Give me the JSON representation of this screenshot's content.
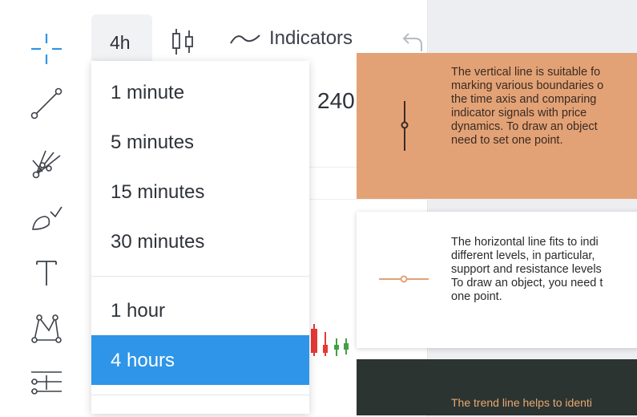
{
  "toolbar": {
    "timeframe_label": "4h",
    "indicators_label": "Indicators"
  },
  "chart": {
    "price_fragment": "240"
  },
  "timeframe_menu": {
    "items": [
      {
        "label": "1 minute",
        "selected": false
      },
      {
        "label": "5 minutes",
        "selected": false
      },
      {
        "label": "15 minutes",
        "selected": false
      },
      {
        "label": "30 minutes",
        "selected": false
      },
      {
        "label": "1 hour",
        "selected": false
      },
      {
        "label": "4 hours",
        "selected": true
      }
    ]
  },
  "tooltips": [
    {
      "text": "The vertical line is suitable fo\nmarking various boundaries o\nthe time axis and comparing\nindicator signals with price\ndynamics. To draw an object\nneed to set one point."
    },
    {
      "text": "The horizontal line fits to indi\ndifferent levels, in particular,\nsupport and resistance levels\nTo draw an object, you need t\none point."
    },
    {
      "text": "The trend line helps to identi"
    }
  ],
  "colors": {
    "accent": "#2e95e8",
    "tooltip_orange": "#e3a276",
    "tooltip_dark": "#2c3432",
    "candle_red": "#e53935",
    "candle_green": "#43a047"
  },
  "icons": [
    "crosshair-icon",
    "trend-line-icon",
    "pitchfork-icon",
    "brush-icon",
    "text-icon",
    "pattern-icon",
    "fibonacci-icon",
    "candlestick-icon",
    "wave-icon",
    "undo-icon",
    "vertical-line-icon",
    "horizontal-line-icon"
  ]
}
